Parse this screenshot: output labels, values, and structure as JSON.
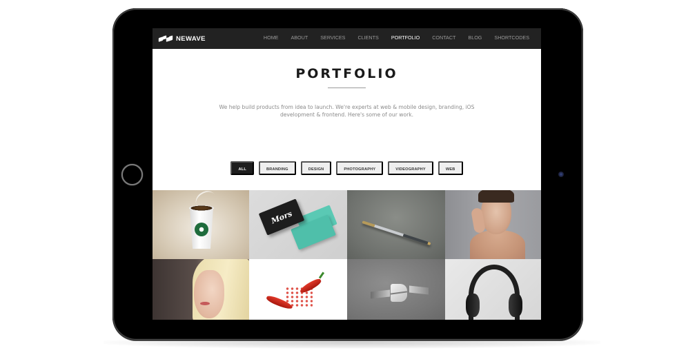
{
  "brand": {
    "name": "NEWAVE",
    "icon": "wave-logo-icon"
  },
  "nav": {
    "items": [
      {
        "label": "HOME",
        "active": false
      },
      {
        "label": "ABOUT",
        "active": false
      },
      {
        "label": "SERVICES",
        "active": false
      },
      {
        "label": "CLIENTS",
        "active": false
      },
      {
        "label": "PORTFOLIO",
        "active": true
      },
      {
        "label": "CONTACT",
        "active": false
      },
      {
        "label": "BLOG",
        "active": false
      },
      {
        "label": "SHORTCODES",
        "active": false
      }
    ]
  },
  "section": {
    "title": "PORTFOLIO",
    "intro": "We help build products from idea to launch. We're experts at web & mobile design, branding, iOS development & frontend. Here's some of our work."
  },
  "filters": [
    {
      "label": "ALL",
      "active": true
    },
    {
      "label": "BRANDING",
      "active": false
    },
    {
      "label": "DESIGN",
      "active": false
    },
    {
      "label": "PHOTOGRAPHY",
      "active": false
    },
    {
      "label": "VIDEOGRAPHY",
      "active": false
    },
    {
      "label": "WEB",
      "active": false
    }
  ],
  "portfolio": {
    "items": [
      {
        "subject": "coffee-cup"
      },
      {
        "subject": "business-cards",
        "card_text": "Mors"
      },
      {
        "subject": "pen"
      },
      {
        "subject": "woman-portrait"
      },
      {
        "subject": "blonde-portrait"
      },
      {
        "subject": "chili-pepper"
      },
      {
        "subject": "embossed-logo"
      },
      {
        "subject": "headphones"
      }
    ]
  },
  "colors": {
    "nav_bg": "#222222",
    "active_filter_bg": "#1e1e1e",
    "filter_bg": "#efefef",
    "device_frame": "#000000"
  }
}
